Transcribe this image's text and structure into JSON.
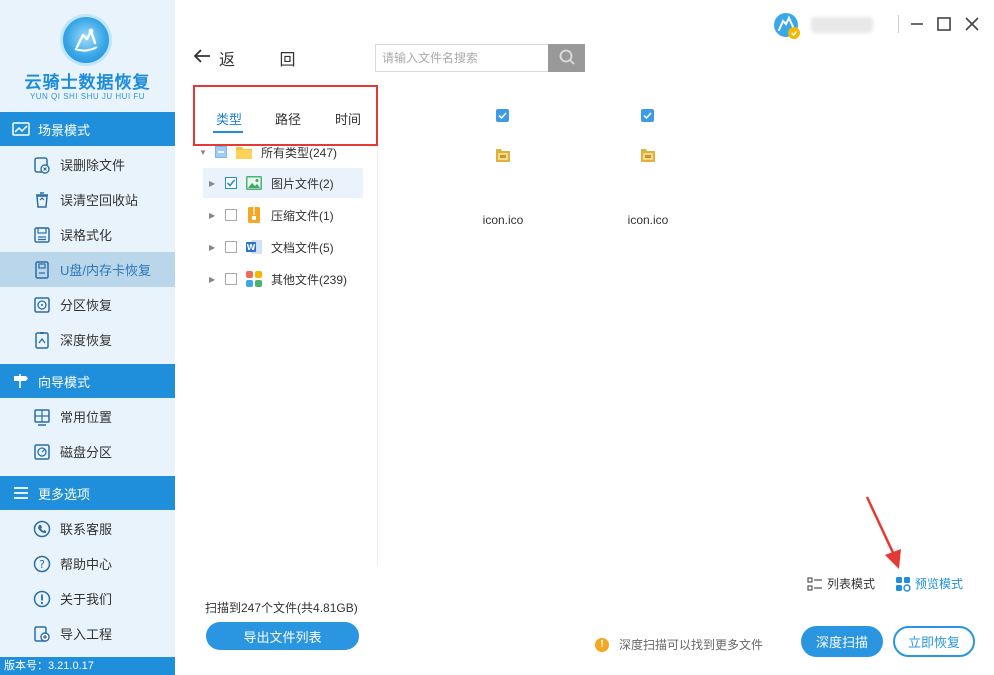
{
  "app": {
    "title": "云骑士数据恢复",
    "subtitle": "YUN QI SHI SHU JU HUI FU",
    "version": "版本号：3.21.0.17"
  },
  "sidebar": {
    "sections": [
      {
        "title": "场景模式",
        "icon": "scene-icon",
        "items": [
          {
            "label": "误删除文件",
            "icon": "deleted-file-icon"
          },
          {
            "label": "误清空回收站",
            "icon": "recycle-bin-icon"
          },
          {
            "label": "误格式化",
            "icon": "format-icon"
          },
          {
            "label": "U盘/内存卡恢复",
            "icon": "usb-card-icon",
            "active": true
          },
          {
            "label": "分区恢复",
            "icon": "partition-icon"
          },
          {
            "label": "深度恢复",
            "icon": "deep-recover-icon"
          }
        ]
      },
      {
        "title": "向导模式",
        "icon": "guide-icon",
        "items": [
          {
            "label": "常用位置",
            "icon": "common-location-icon"
          },
          {
            "label": "磁盘分区",
            "icon": "disk-partition-icon"
          }
        ]
      },
      {
        "title": "更多选项",
        "icon": "menu-icon",
        "items": [
          {
            "label": "联系客服",
            "icon": "phone-icon"
          },
          {
            "label": "帮助中心",
            "icon": "help-icon"
          },
          {
            "label": "关于我们",
            "icon": "info-icon"
          },
          {
            "label": "导入工程",
            "icon": "import-icon"
          }
        ]
      }
    ]
  },
  "header": {
    "back_label": "返 回",
    "search_placeholder": "请输入文件名搜索"
  },
  "tabs": [
    {
      "label": "类型",
      "active": true
    },
    {
      "label": "路径",
      "active": false
    },
    {
      "label": "时间",
      "active": false
    }
  ],
  "tree": [
    {
      "label": "所有类型(247)",
      "icon": "folder-icon",
      "state": "partial",
      "expanded": true
    },
    {
      "label": "图片文件(2)",
      "icon": "image-icon",
      "state": "checked",
      "selected": true
    },
    {
      "label": "压缩文件(1)",
      "icon": "zip-icon",
      "state": "unchecked"
    },
    {
      "label": "文档文件(5)",
      "icon": "doc-icon",
      "state": "unchecked"
    },
    {
      "label": "其他文件(239)",
      "icon": "other-files-icon",
      "state": "unchecked"
    }
  ],
  "files": [
    {
      "name": "icon.ico",
      "checked": true
    },
    {
      "name": "icon.ico",
      "checked": true
    }
  ],
  "view_modes": {
    "list_label": "列表模式",
    "preview_label": "预览模式",
    "active": "preview"
  },
  "footer": {
    "scan_summary": "扫描到247个文件(共4.81GB)",
    "export_label": "导出文件列表",
    "hint": "深度扫描可以找到更多文件",
    "deep_scan_label": "深度扫描",
    "recover_label": "立即恢复"
  },
  "colors": {
    "accent": "#1f8fdb",
    "sidebar_bg": "#e9f3fb",
    "highlight_border": "#e53935",
    "warning": "#f5a623"
  }
}
